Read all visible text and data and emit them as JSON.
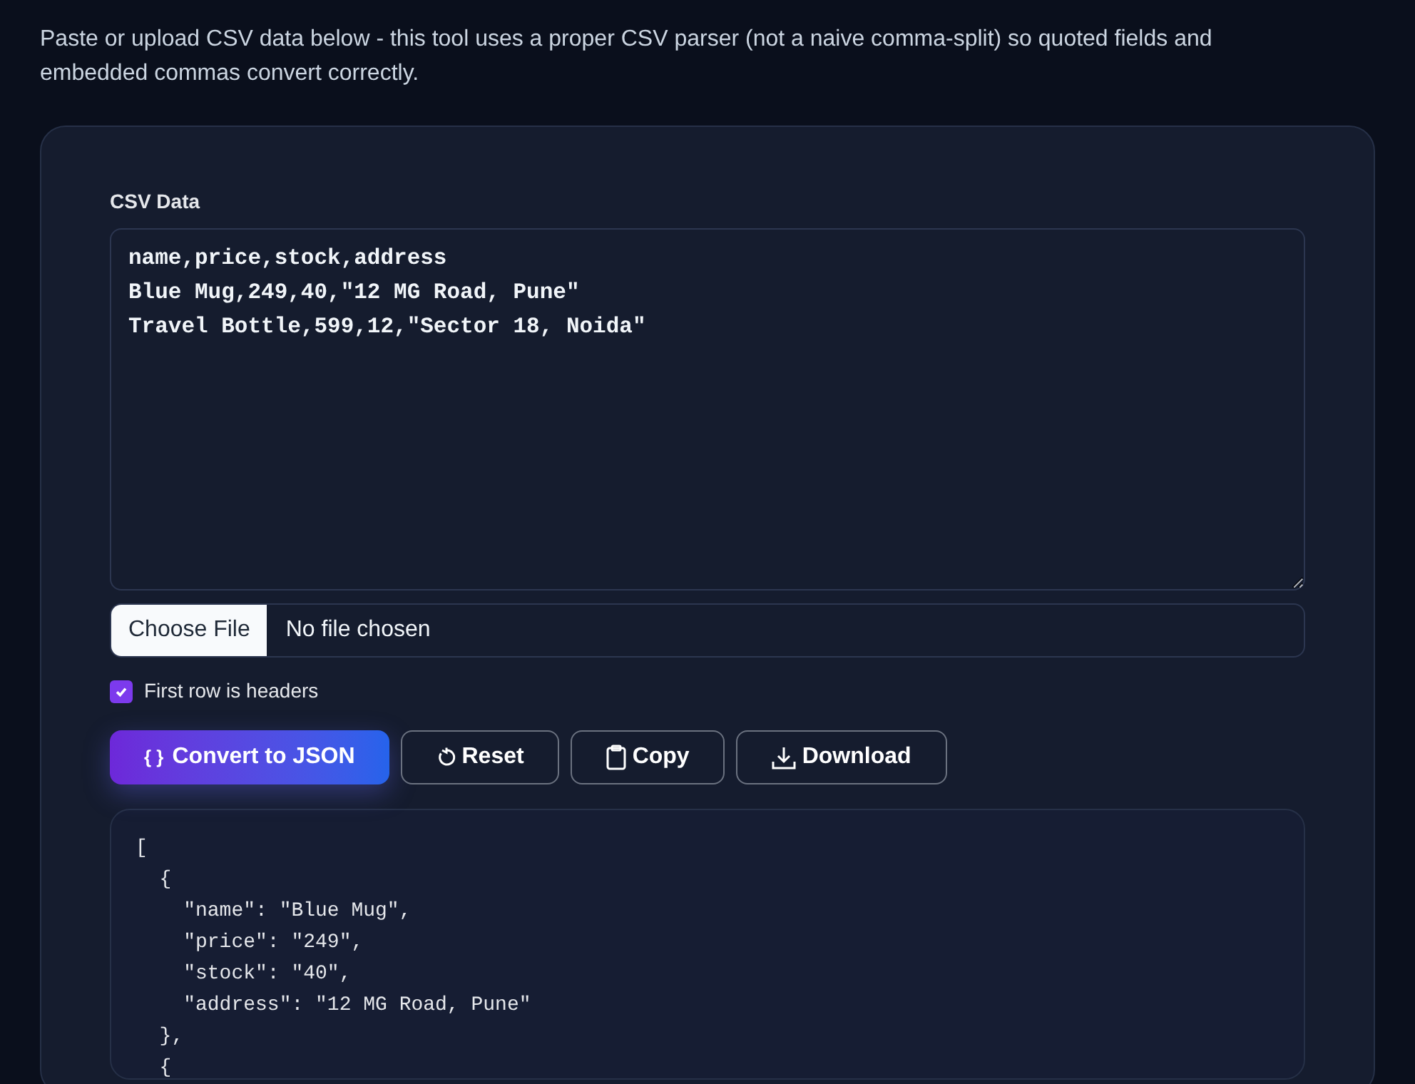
{
  "intro": "Paste or upload CSV data below - this tool uses a proper CSV parser (not a naive comma-split) so quoted fields and embedded commas convert correctly.",
  "csv_field": {
    "label": "CSV Data",
    "value": "name,price,stock,address\nBlue Mug,249,40,\"12 MG Road, Pune\"\nTravel Bottle,599,12,\"Sector 18, Noida\""
  },
  "file_input": {
    "button": "Choose File",
    "status": "No file chosen"
  },
  "headers_checkbox": {
    "label": "First row is headers",
    "checked": true
  },
  "buttons": [
    {
      "kind": "primary",
      "icon": "{ }",
      "label": "Convert to JSON"
    },
    {
      "kind": "reset",
      "label": "Reset"
    },
    {
      "kind": "copy",
      "label": "Copy"
    },
    {
      "kind": "download",
      "label": "Download"
    }
  ],
  "output": [
    "[",
    "  {",
    "    \"name\": \"Blue Mug\",",
    "    \"price\": \"249\",",
    "    \"stock\": \"40\",",
    "    \"address\": \"12 MG Road, Pune\"",
    "  },",
    "  {"
  ]
}
